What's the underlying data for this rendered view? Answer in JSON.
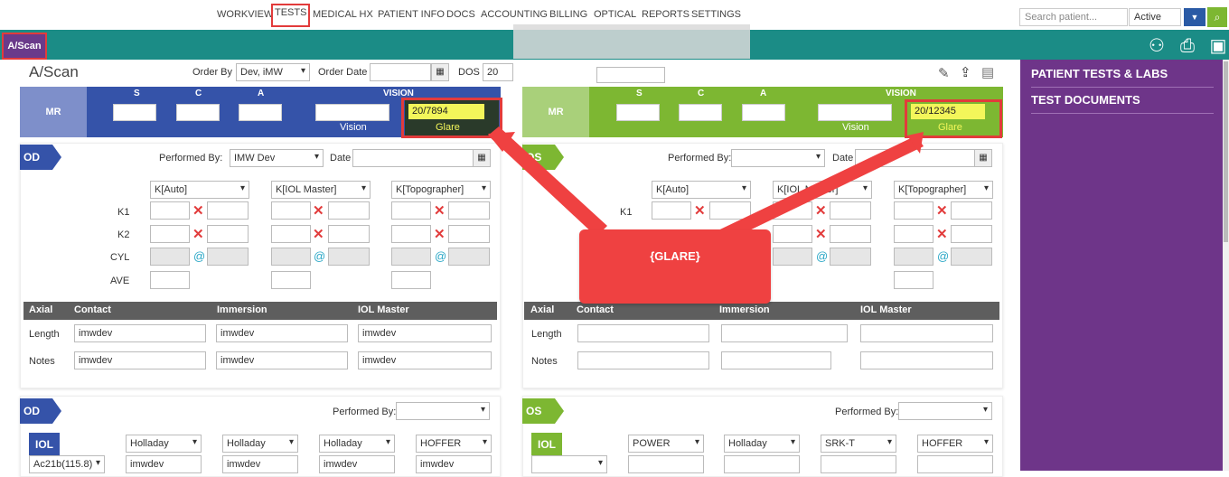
{
  "nav": {
    "items": [
      "WORKVIEW",
      "TESTS",
      "MEDICAL HX",
      "PATIENT INFO",
      "DOCS",
      "ACCOUNTING",
      "BILLING",
      "OPTICAL",
      "REPORTS",
      "SETTINGS"
    ],
    "search_placeholder": "Search patient...",
    "status_value": "Active"
  },
  "tab": {
    "label": "A/Scan"
  },
  "header": {
    "title": "A/Scan",
    "order_by_label": "Order By",
    "order_by_value": "Dev, iMW",
    "order_date_label": "Order Date",
    "dos_label": "DOS",
    "dos_value": "20"
  },
  "sidebar": {
    "items": [
      "PATIENT TESTS & LABS",
      "TEST DOCUMENTS"
    ]
  },
  "vision": {
    "mr": "MR",
    "s": "S",
    "c": "C",
    "a": "A",
    "vision": "VISION",
    "vision_sub": "Vision",
    "glare_label": "Glare",
    "od_glare": "20/7894",
    "os_glare": "20/12345"
  },
  "kpanel": {
    "od_tag": "OD",
    "os_tag": "OS",
    "performed_by_label": "Performed By:",
    "performed_by_od": "IMW Dev",
    "date_label": "Date",
    "k_methods": [
      "K[Auto]",
      "K[IOL Master]",
      "K[Topographer]"
    ],
    "row_labels": [
      "K1",
      "K2",
      "CYL",
      "AVE"
    ],
    "axial_headers": [
      "Axial",
      "Contact",
      "Immersion",
      "IOL Master"
    ],
    "length_label": "Length",
    "notes_label": "Notes",
    "od_values": "imwdev"
  },
  "callout": {
    "text": "{GLARE}"
  },
  "iol": {
    "label": "IOL",
    "od_selected": "Ac21b(115.8)",
    "od_formulas": [
      "Holladay",
      "Holladay",
      "Holladay",
      "HOFFER"
    ],
    "os_formulas": [
      "POWER",
      "Holladay",
      "SRK-T",
      "HOFFER"
    ],
    "od_values": "imwdev"
  },
  "colors": {
    "teal": "#1b8c86",
    "purple": "#6e3589",
    "od_blue": "#3553a9",
    "os_green": "#7db732",
    "callout_red": "#ef4141",
    "glare_yellow": "#f3f65a"
  }
}
